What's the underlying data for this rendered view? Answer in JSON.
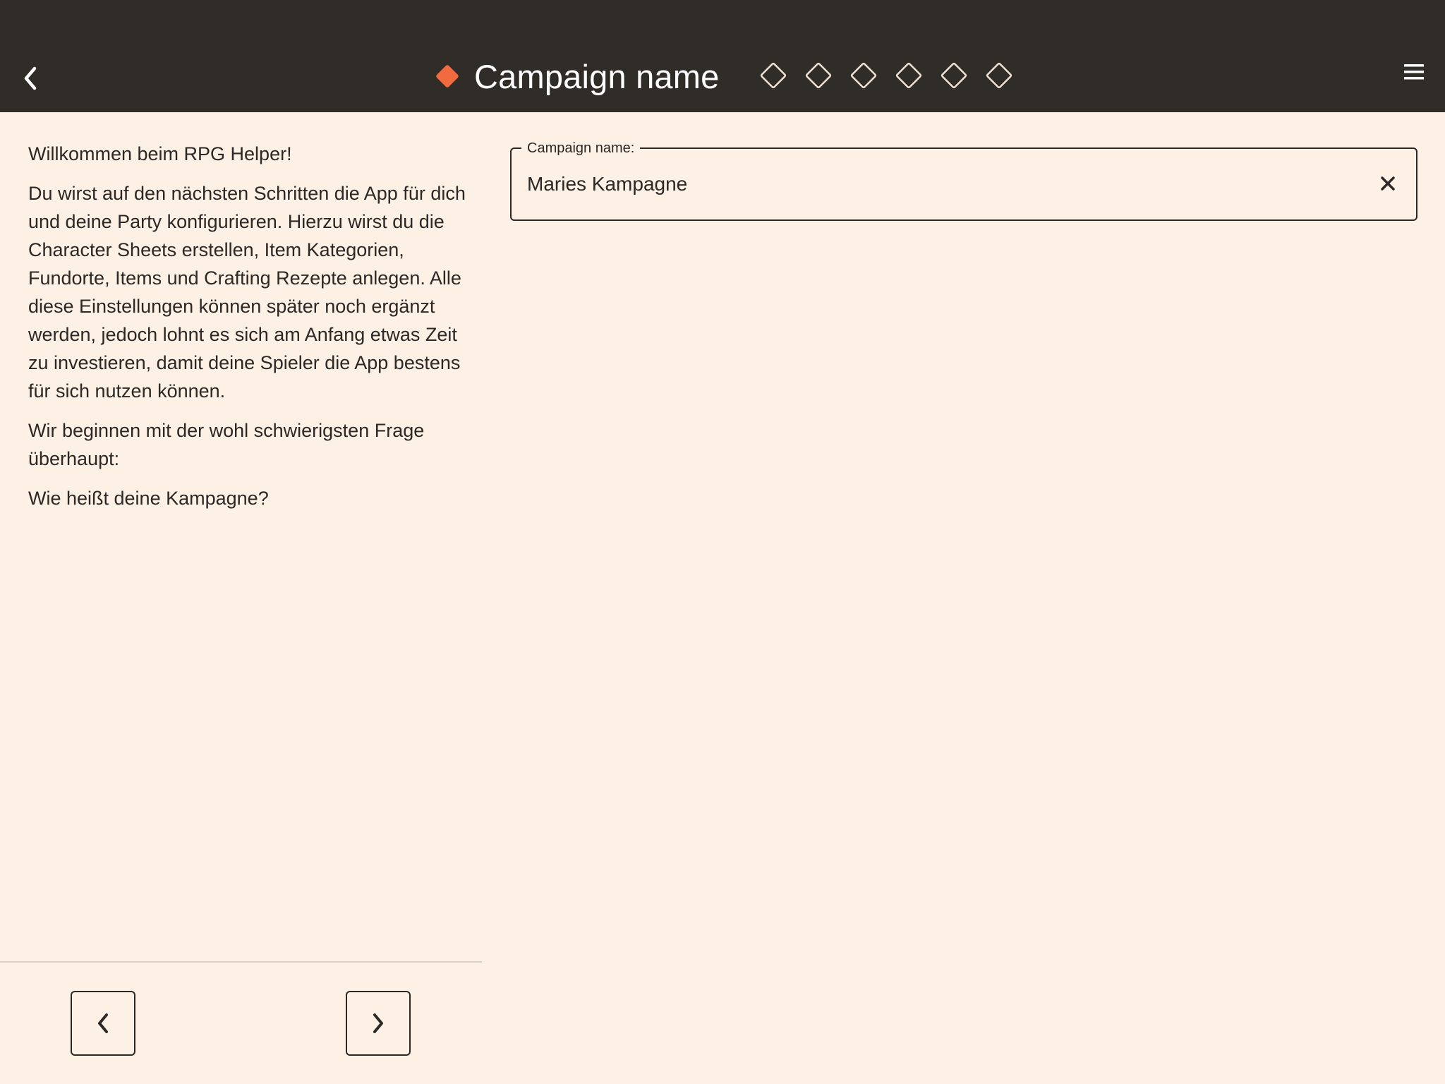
{
  "app_bar": {
    "back_icon": "chevron-left-icon",
    "title": "Campaign name",
    "current_step_icon": "filled-diamond-icon",
    "step_icon": "outline-diamond-icon",
    "steps_total": 7,
    "current_step": 1,
    "menu_icon": "hamburger-menu-icon",
    "accent_color": "#F26A3F",
    "background_color": "#302C28"
  },
  "intro": {
    "paragraphs": [
      "Willkommen beim RPG Helper!",
      "Du wirst auf den nächsten Schritten die App für dich und deine Party konfigurieren. Hierzu wirst du die Character Sheets erstellen, Item Kategorien, Fundorte, Items und Crafting Rezepte anlegen. Alle diese Einstellungen können später noch ergänzt werden, jedoch lohnt es sich am Anfang etwas Zeit zu investieren, damit deine Spieler die App bestens für sich nutzen können.",
      "Wir beginnen mit der wohl schwierigsten Frage überhaupt:",
      "Wie heißt deine Kampagne?"
    ]
  },
  "form": {
    "campaign_name_label": "Campaign name:",
    "campaign_name_value": "Maries Kampagne",
    "clear_icon": "close-icon"
  },
  "navigation": {
    "prev_icon": "chevron-left-icon",
    "next_icon": "chevron-right-icon"
  },
  "colors": {
    "page_background": "#FDF0E4",
    "text": "#2B2826"
  }
}
